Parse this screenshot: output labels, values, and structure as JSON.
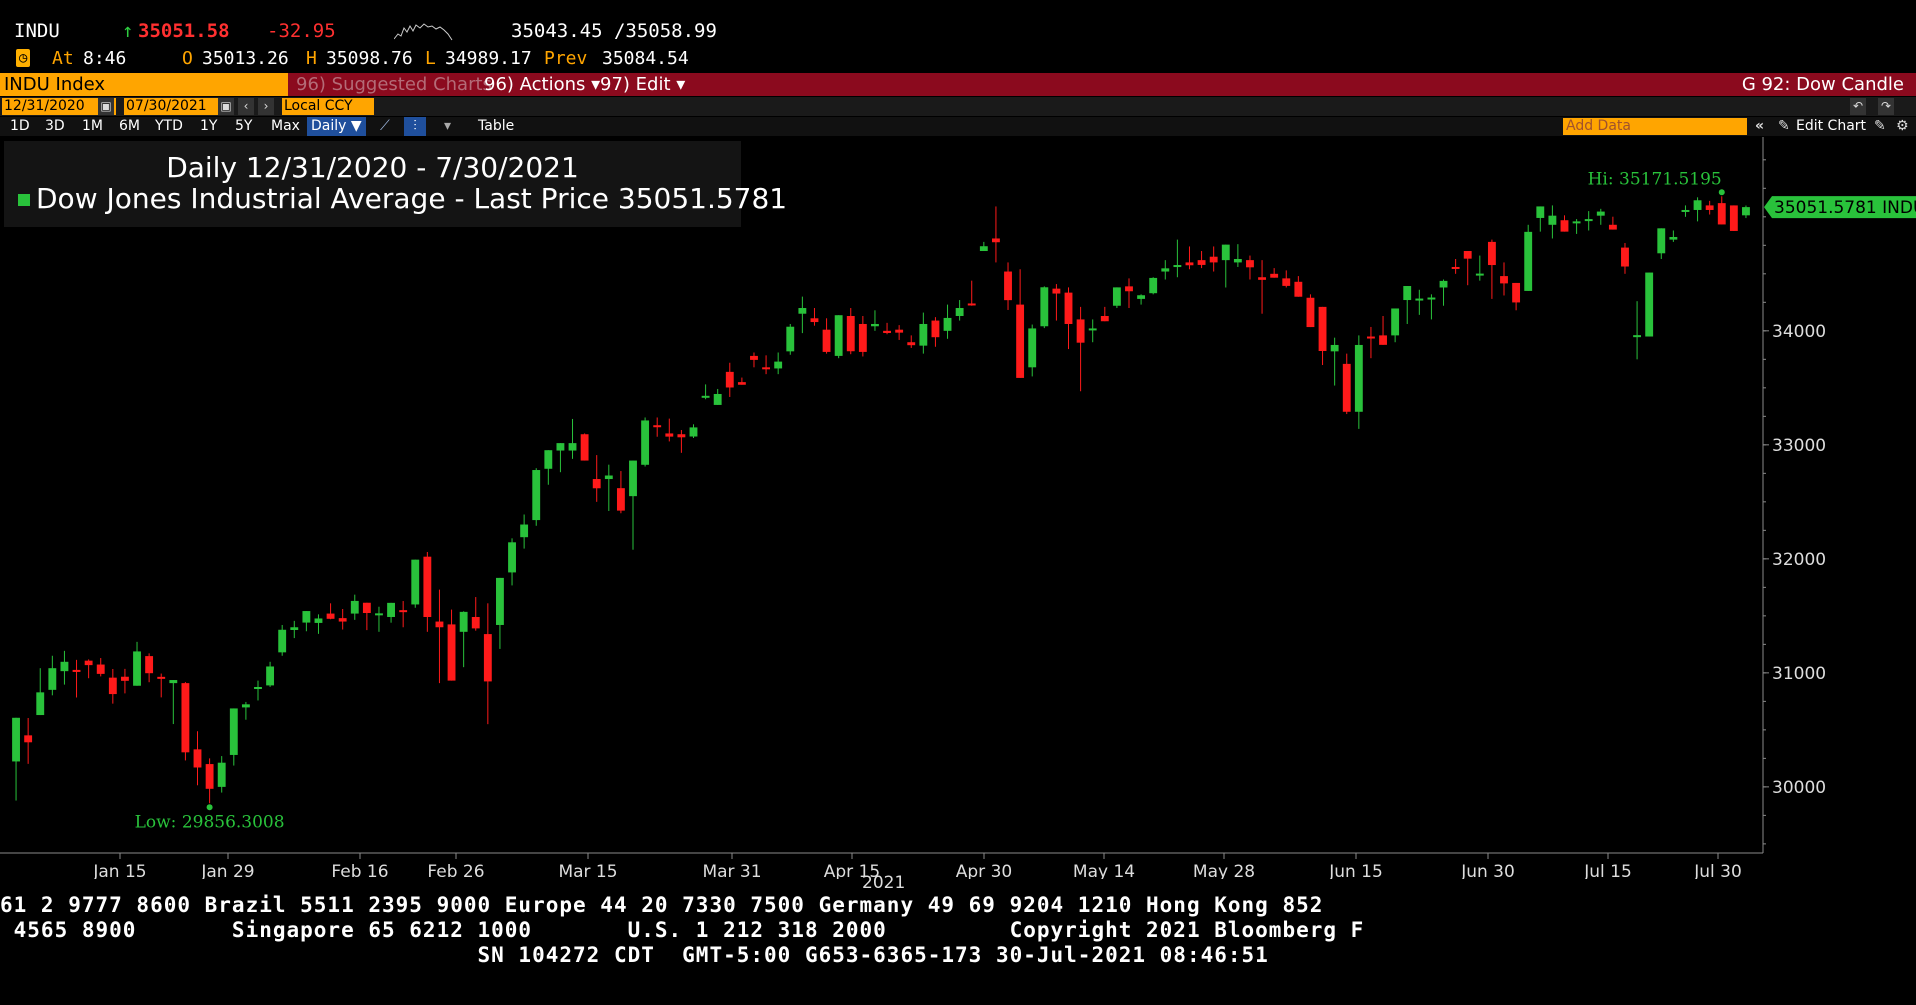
{
  "quote": {
    "ticker": "INDU",
    "last": "35051.58",
    "change": "-32.95",
    "bid_ask": "35043.45 /35058.99",
    "time_label": "At",
    "time": "8:46",
    "open_label": "O",
    "open": "35013.26",
    "high_label": "H",
    "high": "35098.76",
    "low_label": "L",
    "low": "34989.17",
    "prev_label": "Prev",
    "prev": "35084.54"
  },
  "menubar": {
    "security": "INDU Index",
    "suggested": "96) Suggested Charts",
    "actions": "96) Actions ▾",
    "edit": "97) Edit ▾",
    "chart_name": "G 92: Dow Candle"
  },
  "daterow": {
    "start": "12/31/2020",
    "end": "07/30/2021",
    "currency": "Local CCY"
  },
  "ranges": [
    "1D",
    "3D",
    "1M",
    "6M",
    "YTD",
    "1Y",
    "5Y",
    "Max"
  ],
  "period": "Daily ▼",
  "table_label": "Table",
  "add_data_placeholder": "Add Data",
  "edit_chart": "Edit Chart",
  "legend": {
    "title": "Daily 12/31/2020 - 7/30/2021",
    "series": "Dow Jones Industrial Average - Last Price",
    "last": "35051.5781"
  },
  "chart_data": {
    "type": "candlestick",
    "y_ticks": [
      "30000",
      "31000",
      "32000",
      "33000",
      "34000"
    ],
    "x_ticks": [
      "Jan 15",
      "Jan 29",
      "Feb 16",
      "Feb 26",
      "Mar 15",
      "Mar 31",
      "Apr 15",
      "Apr 30",
      "May 14",
      "May 28",
      "Jun 15",
      "Jun 30",
      "Jul 15",
      "Jul 30"
    ],
    "year_label": "2021",
    "hi_label": "Hi: 35171.5195",
    "low_label": "Low: 29856.3008",
    "last_label": "35051.5781 INDU",
    "ylim": [
      29420,
      35700
    ],
    "colors": {
      "up": "#29c23b",
      "down": "#ff1a1a",
      "axis": "#8a8a8a",
      "annot": "#29c23b"
    },
    "ohlc": [
      [
        30223,
        30322,
        29880,
        30606
      ],
      [
        30452,
        30604,
        30202,
        30391
      ],
      [
        30630,
        31041,
        30630,
        30829
      ],
      [
        30851,
        31150,
        30803,
        31041
      ],
      [
        31015,
        31193,
        30897,
        31097
      ],
      [
        31026,
        31114,
        30784,
        31008
      ],
      [
        31107,
        31118,
        30953,
        31068
      ],
      [
        31073,
        31130,
        30969,
        30991
      ],
      [
        30958,
        31034,
        30730,
        30814
      ],
      [
        30966,
        31035,
        30820,
        30930
      ],
      [
        30887,
        31272,
        30887,
        31188
      ],
      [
        31147,
        31171,
        30918,
        30997
      ],
      [
        30965,
        30994,
        30785,
        30960
      ],
      [
        30910,
        30914,
        30551,
        30937
      ],
      [
        30910,
        30919,
        30232,
        30303
      ],
      [
        30329,
        30488,
        30014,
        30170
      ],
      [
        30200,
        30250,
        29856,
        29983
      ],
      [
        30000,
        30270,
        29950,
        30212
      ],
      [
        30280,
        30688,
        30187,
        30688
      ],
      [
        30697,
        30745,
        30589,
        30724
      ],
      [
        30867,
        30932,
        30758,
        30876
      ],
      [
        30890,
        31097,
        30877,
        31056
      ],
      [
        31180,
        31420,
        31150,
        31378
      ],
      [
        31376,
        31456,
        31305,
        31400
      ],
      [
        31441,
        31521,
        31365,
        31542
      ],
      [
        31438,
        31513,
        31342,
        31477
      ],
      [
        31520,
        31610,
        31470,
        31474
      ],
      [
        31480,
        31560,
        31380,
        31450
      ],
      [
        31520,
        31686,
        31465,
        31631
      ],
      [
        31615,
        31610,
        31375,
        31525
      ],
      [
        31520,
        31580,
        31360,
        31522
      ],
      [
        31490,
        31612,
        31440,
        31614
      ],
      [
        31550,
        31630,
        31400,
        31538
      ],
      [
        31600,
        31860,
        31571,
        31993
      ],
      [
        32019,
        32060,
        31360,
        31490
      ],
      [
        31450,
        31730,
        30910,
        31400
      ],
      [
        31425,
        31555,
        30940,
        30932
      ],
      [
        31360,
        31540,
        31050,
        31535
      ],
      [
        31490,
        31665,
        31370,
        31390
      ],
      [
        31340,
        31610,
        30550,
        30925
      ],
      [
        31420,
        31650,
        31210,
        31833
      ],
      [
        31881,
        32180,
        31767,
        32145
      ],
      [
        32190,
        32389,
        32090,
        32301
      ],
      [
        32340,
        32795,
        32290,
        32779
      ],
      [
        32790,
        32850,
        32650,
        32953
      ],
      [
        32950,
        32975,
        32760,
        33015
      ],
      [
        32950,
        33227,
        32877,
        33015
      ],
      [
        33093,
        33100,
        32900,
        32862
      ],
      [
        32700,
        32910,
        32500,
        32619
      ],
      [
        32700,
        32826,
        32420,
        32731
      ],
      [
        32620,
        32770,
        32400,
        32423
      ],
      [
        32550,
        32700,
        32080,
        32862
      ],
      [
        32825,
        33240,
        32810,
        33214
      ],
      [
        33172,
        33240,
        33071,
        33171
      ],
      [
        33100,
        33230,
        33030,
        33072
      ],
      [
        33093,
        33130,
        32930,
        33066
      ],
      [
        33073,
        33180,
        33060,
        33153
      ],
      [
        33430,
        33530,
        33400,
        33430
      ],
      [
        33350,
        33490,
        33400,
        33446
      ],
      [
        33640,
        33720,
        33420,
        33503
      ],
      [
        33550,
        33590,
        33540,
        33527
      ],
      [
        33780,
        33810,
        33680,
        33745
      ],
      [
        33680,
        33785,
        33620,
        33677
      ],
      [
        33670,
        33810,
        33620,
        33730
      ],
      [
        33820,
        34060,
        33790,
        34036
      ],
      [
        34150,
        34300,
        33980,
        34200
      ],
      [
        34110,
        34200,
        34045,
        34077
      ],
      [
        34010,
        34110,
        33800,
        33815
      ],
      [
        33780,
        34130,
        33760,
        34137
      ],
      [
        34130,
        34200,
        33795,
        33821
      ],
      [
        34060,
        34130,
        33775,
        33815
      ],
      [
        34040,
        34180,
        34000,
        34060
      ],
      [
        34000,
        34070,
        33970,
        33981
      ],
      [
        34010,
        34050,
        33920,
        33984
      ],
      [
        33900,
        33960,
        33850,
        33874
      ],
      [
        33870,
        34160,
        33800,
        34060
      ],
      [
        34090,
        34120,
        33860,
        33944
      ],
      [
        34000,
        34230,
        33930,
        34113
      ],
      [
        34130,
        34270,
        34090,
        34200
      ],
      [
        34240,
        34440,
        34220,
        34230
      ],
      [
        34700,
        34780,
        34730,
        34742
      ],
      [
        34810,
        35091,
        34600,
        34777
      ],
      [
        34520,
        34600,
        34183,
        34269
      ],
      [
        34230,
        34540,
        33800,
        33587
      ],
      [
        33680,
        34055,
        33600,
        34021
      ],
      [
        34040,
        34390,
        34024,
        34382
      ],
      [
        34370,
        34410,
        34090,
        34327
      ],
      [
        34335,
        34381,
        33840,
        34060
      ],
      [
        34100,
        34210,
        33470,
        33896
      ],
      [
        34010,
        34100,
        33900,
        34021
      ],
      [
        34130,
        34210,
        34090,
        34084
      ],
      [
        34220,
        34360,
        34200,
        34381
      ],
      [
        34390,
        34460,
        34200,
        34347
      ],
      [
        34280,
        34320,
        34230,
        34312
      ],
      [
        34330,
        34470,
        34320,
        34464
      ],
      [
        34520,
        34620,
        34450,
        34548
      ],
      [
        34560,
        34800,
        34470,
        34577
      ],
      [
        34600,
        34740,
        34540,
        34575
      ],
      [
        34620,
        34700,
        34550,
        34578
      ],
      [
        34650,
        34740,
        34520,
        34600
      ],
      [
        34620,
        34690,
        34380,
        34756
      ],
      [
        34600,
        34760,
        34560,
        34630
      ],
      [
        34620,
        34660,
        34450,
        34557
      ],
      [
        34470,
        34620,
        34150,
        34447
      ],
      [
        34500,
        34550,
        34470,
        34466
      ],
      [
        34460,
        34530,
        34380,
        34394
      ],
      [
        34430,
        34480,
        34300,
        34299
      ],
      [
        34290,
        34320,
        34050,
        34033
      ],
      [
        34210,
        34120,
        33700,
        33823
      ],
      [
        33820,
        33940,
        33520,
        33876
      ],
      [
        33710,
        33800,
        33270,
        33290
      ],
      [
        33290,
        33960,
        33140,
        33876
      ],
      [
        33950,
        34034,
        33760,
        33946
      ],
      [
        33960,
        34130,
        33890,
        33877
      ],
      [
        33960,
        34010,
        33900,
        34196
      ],
      [
        34270,
        34290,
        34060,
        34393
      ],
      [
        34280,
        34360,
        34140,
        34283
      ],
      [
        34280,
        34320,
        34100,
        34292
      ],
      [
        34380,
        34450,
        34220,
        34438
      ],
      [
        34560,
        34630,
        34500,
        34550
      ],
      [
        34700,
        34640,
        34400,
        34633
      ],
      [
        34500,
        34660,
        34440,
        34502
      ],
      [
        34780,
        34800,
        34280,
        34577
      ],
      [
        34480,
        34600,
        34310,
        34416
      ],
      [
        34420,
        34420,
        34180,
        34249
      ],
      [
        34350,
        34930,
        34530,
        34868
      ],
      [
        34990,
        35000,
        34870,
        35091
      ],
      [
        34930,
        35100,
        34810,
        35010
      ],
      [
        34970,
        35013,
        34890,
        34870
      ],
      [
        34950,
        34980,
        34850,
        34960
      ],
      [
        34980,
        35050,
        34880,
        34980
      ],
      [
        35010,
        35070,
        34930,
        35046
      ],
      [
        34930,
        35001,
        34960,
        34888
      ],
      [
        34730,
        34770,
        34500,
        34564
      ],
      [
        33960,
        34260,
        33750,
        33962
      ],
      [
        33950,
        34190,
        34030,
        34511
      ],
      [
        34680,
        34820,
        34630,
        34899
      ],
      [
        34800,
        34880,
        34780,
        34823
      ],
      [
        35060,
        35100,
        35000,
        35060
      ],
      [
        35060,
        35171,
        34960,
        35145
      ],
      [
        35100,
        35140,
        35020,
        35060
      ],
      [
        35120,
        35180,
        34960,
        34933
      ],
      [
        35100,
        35100,
        34880,
        34876
      ],
      [
        35013,
        35099,
        34989,
        35085
      ]
    ]
  },
  "footer": {
    "line1": "61 2 9777 8600 Brazil 5511 2395 9000 Europe 44 20 7330 7500 Germany 49 69 9204 1210 Hong Kong 852",
    "line2": " 4565 8900       Singapore 65 6212 1000       U.S. 1 212 318 2000         Copyright 2021 Bloomberg F",
    "line3": "                                   SN 104272 CDT  GMT-5:00 G653-6365-173 30-Jul-2021 08:46:51"
  }
}
